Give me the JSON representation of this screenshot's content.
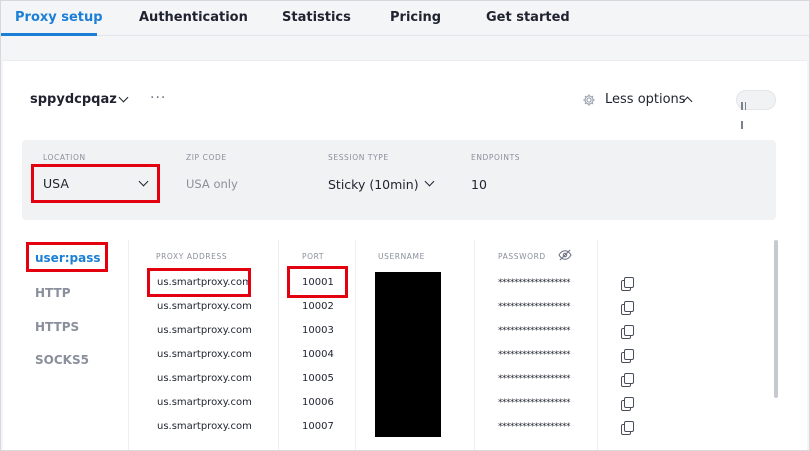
{
  "tabs": [
    {
      "label": "Proxy setup"
    },
    {
      "label": "Authentication"
    },
    {
      "label": "Statistics"
    },
    {
      "label": "Pricing"
    },
    {
      "label": "Get started"
    }
  ],
  "account": {
    "name": "sppydcpqaz",
    "more": "···"
  },
  "options": {
    "less_options_label": "Less options"
  },
  "filters": {
    "location": {
      "label": "LOCATION",
      "value": "USA"
    },
    "zip": {
      "label": "ZIP CODE",
      "value": "USA only"
    },
    "session": {
      "label": "SESSION TYPE",
      "value": "Sticky (10min)"
    },
    "endpoints": {
      "label": "ENDPOINTS",
      "value": "10"
    }
  },
  "protocols": [
    {
      "label": "user:pass"
    },
    {
      "label": "HTTP"
    },
    {
      "label": "HTTPS"
    },
    {
      "label": "SOCKS5"
    }
  ],
  "table": {
    "headers": {
      "address": "PROXY ADDRESS",
      "port": "PORT",
      "username": "USERNAME",
      "password": "PASSWORD"
    },
    "rows": [
      {
        "address": "us.smartproxy.com",
        "port": "10001",
        "password": "******************"
      },
      {
        "address": "us.smartproxy.com",
        "port": "10002",
        "password": "******************"
      },
      {
        "address": "us.smartproxy.com",
        "port": "10003",
        "password": "******************"
      },
      {
        "address": "us.smartproxy.com",
        "port": "10004",
        "password": "******************"
      },
      {
        "address": "us.smartproxy.com",
        "port": "10005",
        "password": "******************"
      },
      {
        "address": "us.smartproxy.com",
        "port": "10006",
        "password": "******************"
      },
      {
        "address": "us.smartproxy.com",
        "port": "10007",
        "password": "******************"
      }
    ]
  },
  "colors": {
    "accent": "#1b7fd6",
    "highlight": "#e3000f"
  }
}
